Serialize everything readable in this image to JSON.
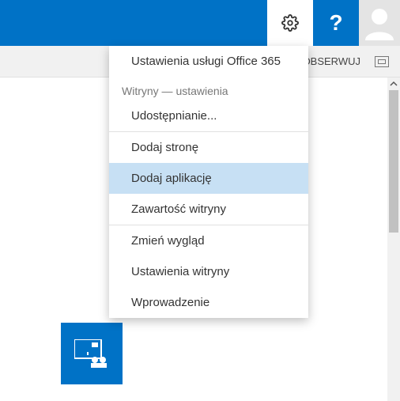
{
  "topbar": {
    "help_glyph": "?"
  },
  "subbar": {
    "follow_label": "OBSERWUJ"
  },
  "menu": {
    "office_settings": "Ustawienia usługi Office 365",
    "section_header": "Witryny — ustawienia",
    "share": "Udostępnianie...",
    "add_page": "Dodaj stronę",
    "add_app": "Dodaj aplikację",
    "site_contents": "Zawartość witryny",
    "change_look": "Zmień wygląd",
    "site_settings": "Ustawienia witryny",
    "getting_started": "Wprowadzenie"
  }
}
